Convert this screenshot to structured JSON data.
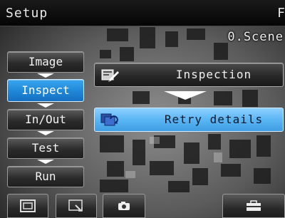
{
  "header": {
    "title": "Setup",
    "right_text": "F"
  },
  "scene": {
    "label": "0.Scene"
  },
  "menu": {
    "items": [
      {
        "label": "Image",
        "active": false
      },
      {
        "label": "Inspect",
        "active": true
      },
      {
        "label": "In/Out",
        "active": false
      },
      {
        "label": "Test",
        "active": false
      },
      {
        "label": "Run",
        "active": false
      }
    ]
  },
  "panels": {
    "inspection": {
      "label": "Inspection",
      "icon": "inspection-icon"
    },
    "retry": {
      "label": "Retry details",
      "icon": "retry-details-icon"
    }
  },
  "toolbar": {
    "buttons": [
      {
        "icon": "display-frame-icon"
      },
      {
        "icon": "zoom-window-icon"
      },
      {
        "icon": "camera-icon"
      },
      {
        "icon": "toolbox-icon"
      }
    ]
  },
  "colors": {
    "active_blue": "#1f86d8",
    "highlight_blue": "#5ab6f4"
  }
}
